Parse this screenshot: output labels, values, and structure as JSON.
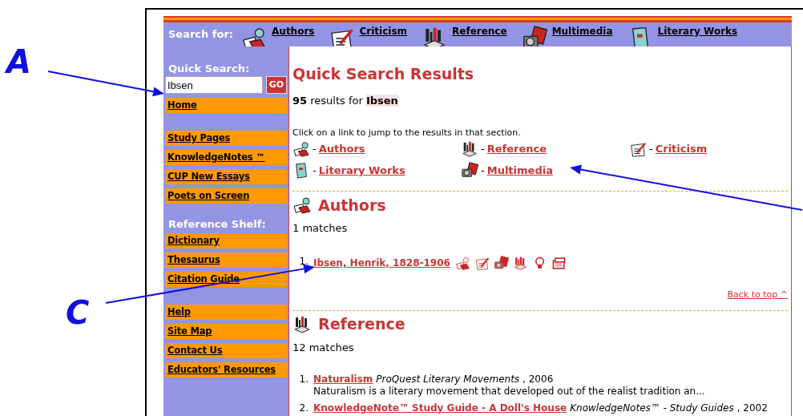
{
  "annotations": [
    {
      "label": "A"
    },
    {
      "label": "C"
    }
  ],
  "nav": {
    "label": "Search for:",
    "items": [
      {
        "kind": "authors",
        "label": "Authors"
      },
      {
        "kind": "criticism",
        "label": "Criticism"
      },
      {
        "kind": "reference",
        "label": "Reference"
      },
      {
        "kind": "multimedia",
        "label": "Multimedia"
      },
      {
        "kind": "literary_works",
        "label": "Literary Works"
      }
    ]
  },
  "sidebar": {
    "search_label": "Quick Search:",
    "search_value": "Ibsen",
    "go_button": "GO",
    "groups": [
      {
        "items": [
          "Home"
        ]
      },
      {
        "items": [
          "Study Pages",
          "KnowledgeNotes ™",
          "CUP New Essays",
          "Poets on Screen"
        ]
      },
      {
        "heading": "Reference Shelf:",
        "items": [
          "Dictionary",
          "Thesaurus",
          "Citation Guide"
        ]
      },
      {
        "items": [
          "Help",
          "Site Map",
          "Contact Us",
          "Educators' Resources"
        ]
      }
    ]
  },
  "content": {
    "title": "Quick Search Results",
    "summary": {
      "count": "95",
      "text": "results for",
      "term": "Ibsen"
    },
    "instruction": "Click on a link to jump to the results in that section.",
    "jump_links": [
      {
        "kind": "authors",
        "separator": "-",
        "label": "Authors"
      },
      {
        "kind": "reference",
        "separator": "-",
        "label": "Reference"
      },
      {
        "kind": "criticism",
        "separator": "-",
        "label": "Criticism"
      },
      {
        "kind": "literary_works",
        "separator": "-",
        "label": "Literary Works"
      },
      {
        "kind": "multimedia",
        "separator": "-",
        "label": "Multimedia"
      }
    ],
    "sections": [
      {
        "kind": "authors",
        "title": "Authors",
        "count": "1 matches",
        "results": [
          {
            "number": "1.",
            "title": "Ibsen, Henrik, 1828-1906"
          }
        ],
        "back_link": "Back to top ^"
      },
      {
        "kind": "reference",
        "title": "Reference",
        "count": "12 matches",
        "results": [
          {
            "number": "1.",
            "title": "Naturalism",
            "source": "ProQuest Literary Movements",
            "year": ", 2006",
            "snippet": "Naturalism is a literary movement that developed out of the realist tradition an..."
          },
          {
            "number": "2.",
            "title": "KnowledgeNote™ Study Guide - A Doll's House",
            "source": "KnowledgeNotes™ - Study Guides",
            "year": ", 2002"
          }
        ]
      }
    ]
  }
}
